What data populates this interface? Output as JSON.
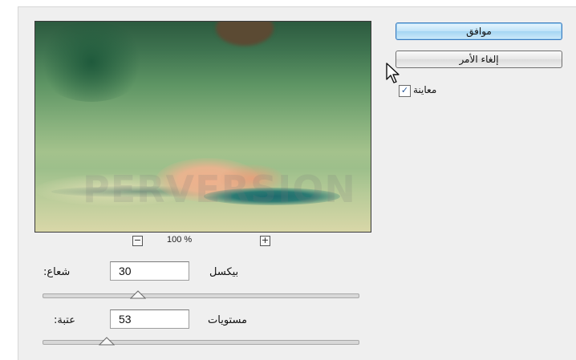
{
  "buttons": {
    "ok_label": "موافق",
    "cancel_label": "إلغاء الأمر"
  },
  "preview_toggle": {
    "label": "معاينة",
    "checked": true,
    "check_glyph": "✓"
  },
  "zoom": {
    "level": "100 %",
    "minus_glyph": "−",
    "plus_glyph": "+"
  },
  "watermark": "PERVERSION",
  "params": {
    "radius": {
      "label": ":شعاع",
      "value": "30",
      "unit": "بيكسل",
      "slider_fraction": 0.3
    },
    "threshold": {
      "label": ":عتبة",
      "value": "53",
      "unit": "مستويات",
      "slider_fraction": 0.2
    }
  },
  "colors": {
    "ok_button_border": "#3a7bbf",
    "dialog_bg": "#efefef"
  },
  "icons": [
    "zoom-out-icon",
    "zoom-in-icon",
    "check-icon",
    "mouse-cursor-icon",
    "slider-thumb-icon"
  ]
}
